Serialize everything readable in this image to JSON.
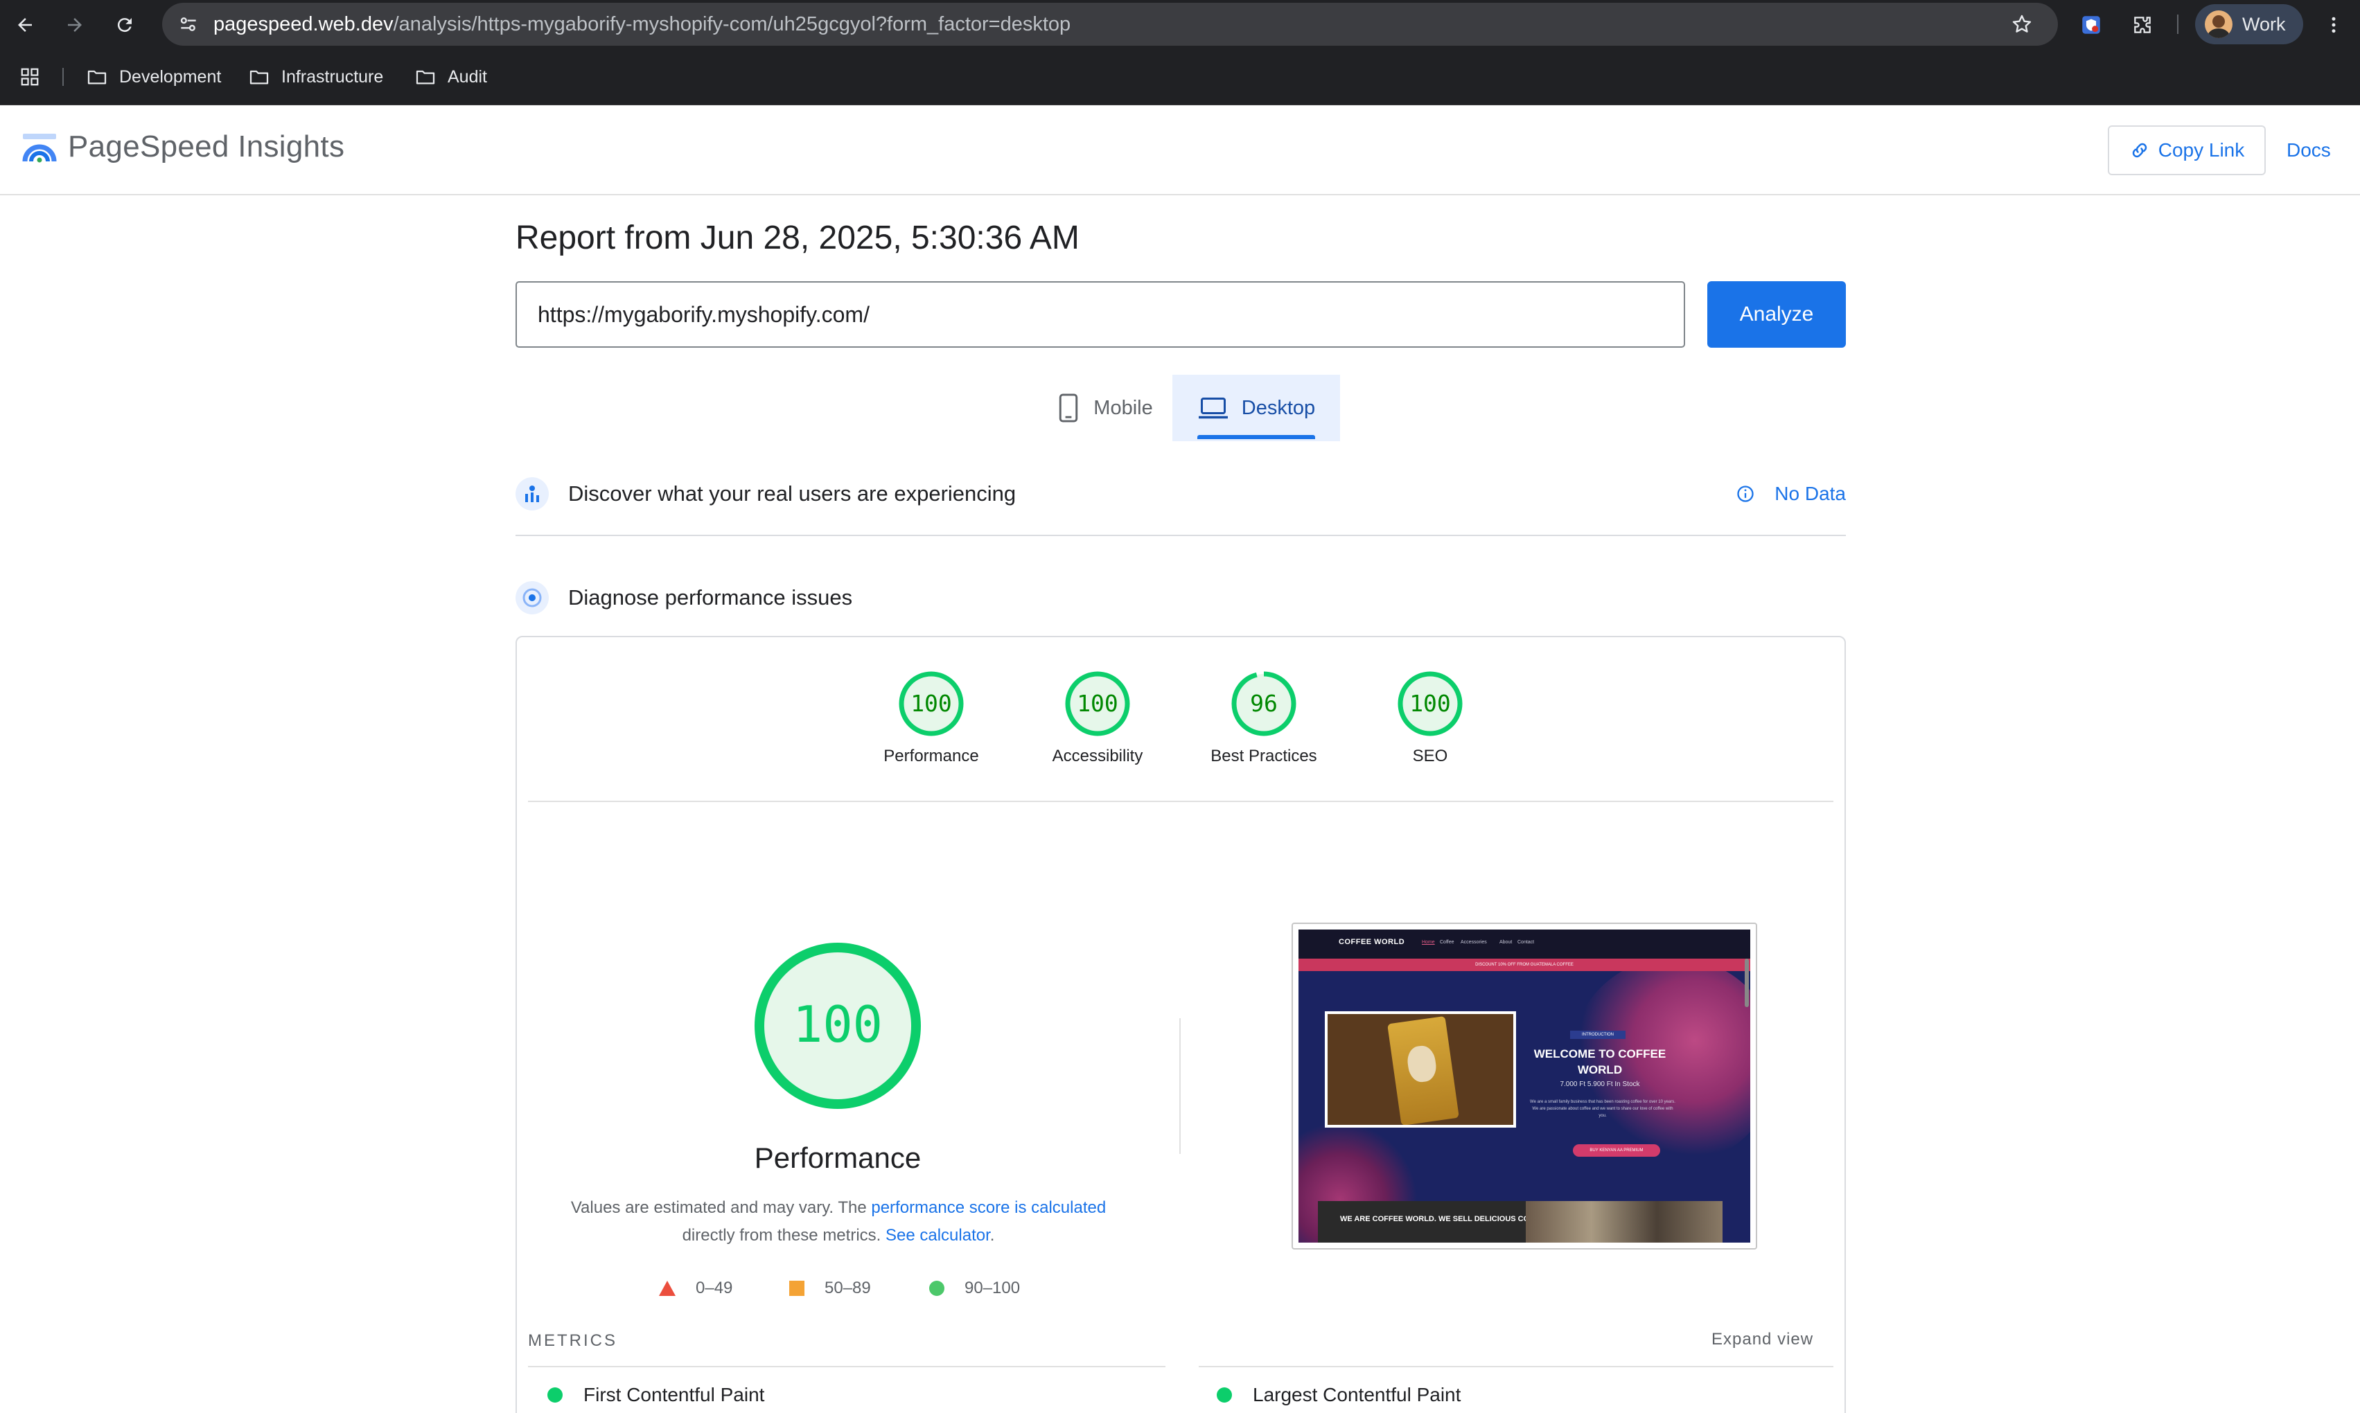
{
  "browser": {
    "url_host": "pagespeed.web.dev",
    "url_path": "/analysis/https-mygaborify-myshopify-com/uh25gcgyol?form_factor=desktop",
    "profile_label": "Work",
    "bookmarks": [
      "Development",
      "Infrastructure",
      "Audit"
    ]
  },
  "header": {
    "title": "PageSpeed Insights",
    "copy_link": "Copy Link",
    "docs": "Docs"
  },
  "report": {
    "title": "Report from Jun 28, 2025, 5:30:36 AM",
    "url_value": "https://mygaborify.myshopify.com/",
    "analyze": "Analyze",
    "tabs": {
      "mobile": "Mobile",
      "desktop": "Desktop",
      "selected": "desktop"
    }
  },
  "field_data": {
    "heading": "Discover what your real users are experiencing",
    "status": "No Data"
  },
  "lab_data": {
    "heading": "Diagnose performance issues",
    "scores": [
      {
        "label": "Performance",
        "value": "100",
        "fraction": 1.0
      },
      {
        "label": "Accessibility",
        "value": "100",
        "fraction": 1.0
      },
      {
        "label": "Best Practices",
        "value": "96",
        "fraction": 0.96
      },
      {
        "label": "SEO",
        "value": "100",
        "fraction": 1.0
      }
    ],
    "main_score": {
      "value": "100",
      "label": "Performance",
      "fraction": 1.0
    },
    "desc_pre": "Values are estimated and may vary. The ",
    "desc_link1": "performance score is calculated",
    "desc_mid": " directly from these metrics. ",
    "desc_link2": "See calculator",
    "desc_end": ".",
    "legend": [
      {
        "range": "0–49",
        "color": "#eb4e3d",
        "shape": "triangle"
      },
      {
        "range": "50–89",
        "color": "#f4a335",
        "shape": "square"
      },
      {
        "range": "90–100",
        "color": "#4cc86a",
        "shape": "circle"
      }
    ],
    "metrics_label": "METRICS",
    "expand_view": "Expand view",
    "metrics": [
      "First Contentful Paint",
      "Largest Contentful Paint"
    ]
  },
  "preview": {
    "brand": "COFFEE WORLD",
    "menu": [
      "Home",
      "Coffee",
      "Accessories",
      "About",
      "Contact"
    ],
    "banner": "DISCOUNT   10% OFF FROM GUATEMALA COFFEE",
    "tag": "INTRODUCTION",
    "headline": "WELCOME TO COFFEE WORLD",
    "price": "7.000 Ft  5.900 Ft In Stock",
    "body": "We are a small family business that has been roasting coffee for over 10 years. We are passionate about coffee and we want to share our love of coffee with you.",
    "button": "BUY KENYAN AA PREMIUM",
    "card": "WE ARE COFFEE WORLD. WE SELL DELICIOUS COFFEE"
  },
  "colors": {
    "pass": "#0cce6b",
    "pass_fill": "#e6f7ea",
    "link": "#1a73e8"
  }
}
